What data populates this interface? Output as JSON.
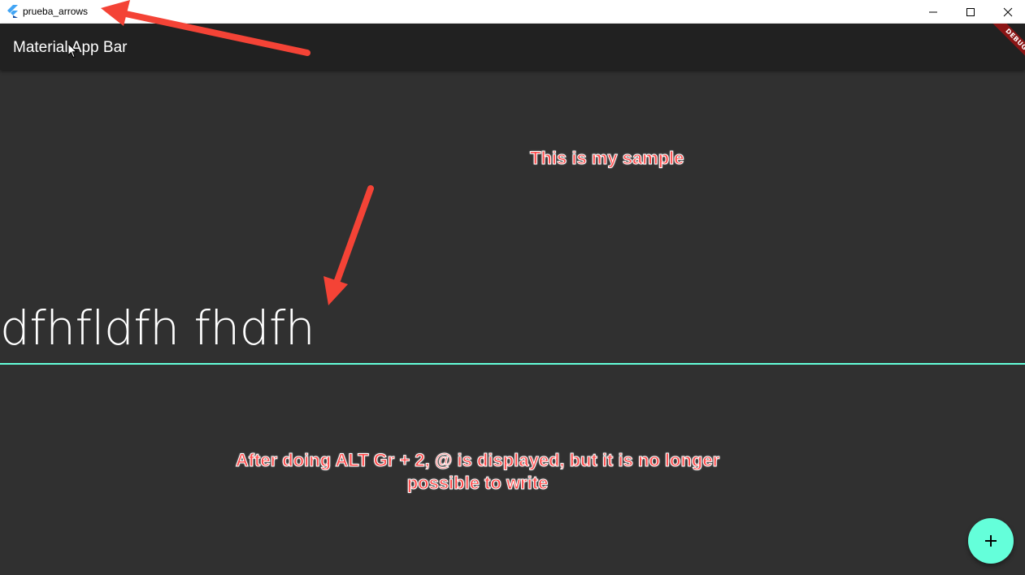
{
  "window": {
    "title": "prueba_arrows",
    "icons": {
      "app": "flutter-logo-icon",
      "minimize": "minimize-icon",
      "maximize": "maximize-icon",
      "close": "close-icon"
    }
  },
  "appbar": {
    "title": "Material App Bar",
    "debug_banner": "DEBUG"
  },
  "textfield": {
    "value": "dfhfldfh fhdfh",
    "underline_color": "#64ffda"
  },
  "annotations": {
    "sample": "This is my sample",
    "bottom_line1": "After doing ALT Gr + 2, @ is displayed, but it is no longer",
    "bottom_line2": "possible to write",
    "color": "#ff4a4a"
  },
  "fab": {
    "icon": "add-icon",
    "color": "#64ffda"
  },
  "colors": {
    "background": "#303030",
    "appbar": "#212121",
    "accent": "#64ffda"
  }
}
